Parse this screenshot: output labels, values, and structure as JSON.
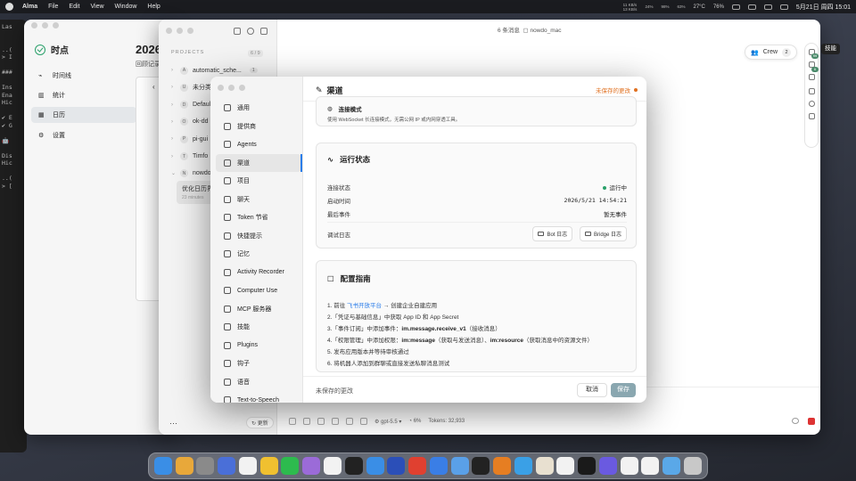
{
  "menubar": {
    "app": "Alma",
    "items": [
      "File",
      "Edit",
      "View",
      "Window",
      "Help"
    ],
    "net_up": "11 KB/s",
    "net_down": "13 KB/s",
    "cpu": "24%",
    "mem": "98%",
    "disk": "63%",
    "temp": "27°C",
    "battery": "76%",
    "datetime": "5月21日 周四 15:01"
  },
  "terminal": {
    "lines": [
      "Las",
      "",
      "",
      "..(",
      "> I",
      "",
      "###",
      "",
      "Ins",
      "Ena",
      "Hic",
      "",
      "✔ E",
      "✔ G",
      "",
      "🤖",
      "",
      "Dis",
      "Hic",
      "",
      "..(",
      "> ["
    ]
  },
  "app_window": {
    "logo": "时点",
    "nav": [
      "时间线",
      "统计",
      "日历",
      "设置"
    ],
    "title": "2026",
    "subtitle": "回顾记录"
  },
  "main_window": {
    "session_count": "6 条消息",
    "project_name": "nowdo_mac",
    "projects_header": "PROJECTS",
    "projects_count": "6 / 9",
    "projects": [
      {
        "initial": "A",
        "name": "automatic_sche...",
        "badge": "1"
      },
      {
        "initial": "U",
        "name": "未分类",
        "badge": ""
      },
      {
        "initial": "D",
        "name": "Default",
        "badge": ""
      },
      {
        "initial": "O",
        "name": "ok-dd",
        "badge": ""
      },
      {
        "initial": "P",
        "name": "pi-gui",
        "badge": ""
      },
      {
        "initial": "T",
        "name": "Timfo",
        "badge": ""
      },
      {
        "initial": "N",
        "name": "nowdo_",
        "badge": ""
      }
    ],
    "session_title": "优化日历界",
    "session_time": "23 minutes",
    "more": "···",
    "update": "更新",
    "crew_label": "Crew",
    "crew_count": "2",
    "badge_top": "99",
    "badge_mid": "6",
    "model": "gpt-5.5",
    "context": "6%",
    "tokens": "Tokens: 32,933",
    "skill_tag": "技能"
  },
  "settings": {
    "sidebar": [
      "通用",
      "提供商",
      "Agents",
      "渠道",
      "项目",
      "聊天",
      "Token 节省",
      "快捷提示",
      "记忆",
      "Activity Recorder",
      "Computer Use",
      "MCP 服务器",
      "技能",
      "Plugins",
      "钩子",
      "语音",
      "Text-to-Speech"
    ],
    "active_index": 3,
    "title": "渠道",
    "unsaved_header": "未保存的更改",
    "connection": {
      "title": "连接模式",
      "desc": "使用 WebSocket 长连接模式，无需公网 IP 或内网穿透工具。"
    },
    "status": {
      "title": "运行状态",
      "conn_label": "连接状态",
      "conn_value": "运行中",
      "start_label": "启动时间",
      "start_value": "2026/5/21 14:54:21",
      "last_label": "最后事件",
      "last_value": "暂无事件",
      "debug_label": "调试日志",
      "bot_log": "Bot 日志",
      "bridge_log": "Bridge 日志"
    },
    "guide": {
      "title": "配置指南",
      "step1_pre": "1. 前往",
      "step1_link": "飞书开放平台",
      "step1_post": "→ 创建企业自建应用",
      "step2": "2.「凭证与基础信息」中获取 App ID 和 App Secret",
      "step3_pre": "3.「事件订阅」中添加事件：",
      "step3_bold": "im.message.receive_v1",
      "step3_post": "（接收消息）",
      "step4_pre": "4.「权限管理」中添加权限：",
      "step4_bold1": "im:message",
      "step4_mid": "（获取与发送消息）、",
      "step4_bold2": "im:resource",
      "step4_post": "（获取消息中的资源文件）",
      "step5": "5. 发布应用版本并等待审核通过",
      "step6": "6. 将机器人添加到群聊或直接发送私聊消息测试"
    },
    "footer_unsaved": "未保存的更改",
    "cancel": "取消",
    "save": "保存"
  },
  "dock": {
    "icons": [
      {
        "name": "finder-icon",
        "color": "#3a8ee6"
      },
      {
        "name": "launchpad-icon",
        "color": "#e8a83a"
      },
      {
        "name": "settings-icon",
        "color": "#8a8a8a"
      },
      {
        "name": "app-icon-1",
        "color": "#4a6fd8"
      },
      {
        "name": "notes-icon",
        "color": "#f2f2f2"
      },
      {
        "name": "app-icon-2",
        "color": "#f0c030"
      },
      {
        "name": "wechat-icon",
        "color": "#2dbb4e"
      },
      {
        "name": "app-icon-3",
        "color": "#9b6bd8"
      },
      {
        "name": "chatgpt-icon",
        "color": "#f2f2f2"
      },
      {
        "name": "qq-icon",
        "color": "#222222"
      },
      {
        "name": "mail-icon",
        "color": "#3a8ee6"
      },
      {
        "name": "grid-app-icon",
        "color": "#2b4fb8"
      },
      {
        "name": "chrome-icon",
        "color": "#e04030"
      },
      {
        "name": "app-icon-4",
        "color": "#3a7ee6"
      },
      {
        "name": "app-icon-5",
        "color": "#5aa0e8"
      },
      {
        "name": "cursor-icon",
        "color": "#222222"
      },
      {
        "name": "app-icon-6",
        "color": "#e67e22"
      },
      {
        "name": "app-icon-7",
        "color": "#3aa0e6"
      },
      {
        "name": "app-icon-8",
        "color": "#e8e0d0"
      },
      {
        "name": "nowdo-icon",
        "color": "#f2f2f2"
      },
      {
        "name": "app-icon-9",
        "color": "#1a1a1a"
      },
      {
        "name": "app-icon-10",
        "color": "#6a5ae0"
      },
      {
        "name": "app-icon-11",
        "color": "#f2f2f2"
      },
      {
        "name": "app-icon-12",
        "color": "#f2f2f2"
      },
      {
        "name": "folder-icon",
        "color": "#5aa8e8"
      },
      {
        "name": "trash-icon",
        "color": "#c8c8c8"
      }
    ]
  }
}
